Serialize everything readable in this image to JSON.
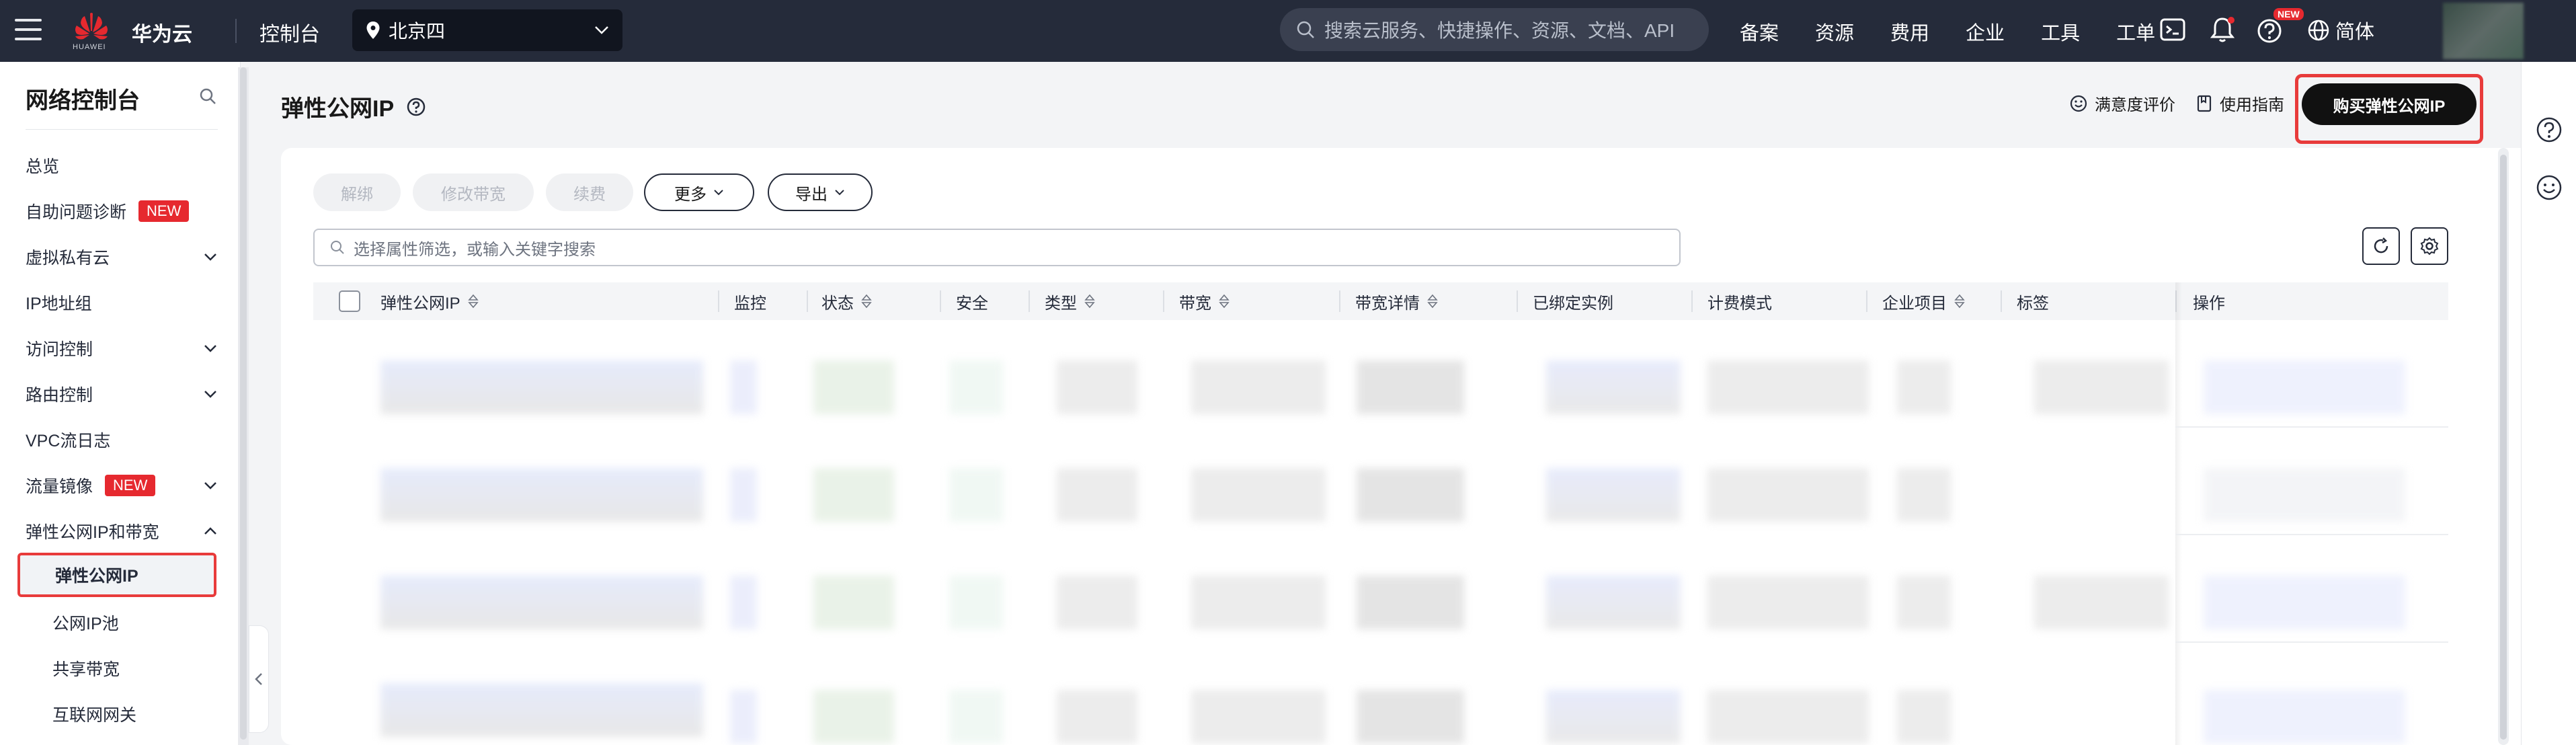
{
  "topbar": {
    "brand_small": "HUAWEI",
    "brand_name": "华为云",
    "console": "控制台",
    "region": "北京四",
    "search_placeholder": "搜索云服务、快捷操作、资源、文档、API",
    "nav": [
      "备案",
      "资源",
      "费用",
      "企业",
      "工具",
      "工单"
    ],
    "notify_badge": "NEW",
    "language": "简体"
  },
  "sidebar": {
    "title": "网络控制台",
    "items": [
      {
        "label": "总览"
      },
      {
        "label": "自助问题诊断",
        "badge": "NEW"
      },
      {
        "label": "虚拟私有云"
      },
      {
        "label": "IP地址组"
      },
      {
        "label": "访问控制"
      },
      {
        "label": "路由控制"
      },
      {
        "label": "VPC流日志"
      },
      {
        "label": "流量镜像",
        "badge": "NEW"
      },
      {
        "label": "弹性公网IP和带宽"
      },
      {
        "label": "弹性公网IP"
      },
      {
        "label": "公网IP池"
      },
      {
        "label": "共享带宽"
      },
      {
        "label": "互联网网关"
      }
    ]
  },
  "main": {
    "title": "弹性公网IP",
    "links": {
      "rating": "满意度评价",
      "guide": "使用指南"
    },
    "buy_button": "购买弹性公网IP",
    "toolbar": {
      "unbind": "解绑",
      "modify_bandwidth": "修改带宽",
      "renew": "续费",
      "more": "更多",
      "export": "导出"
    },
    "filter_placeholder": "选择属性筛选，或输入关键字搜索",
    "columns": [
      "弹性公网IP",
      "监控",
      "状态",
      "安全",
      "类型",
      "带宽",
      "带宽详情",
      "已绑定实例",
      "计费模式",
      "企业项目",
      "标签",
      "操作"
    ]
  },
  "colors": {
    "topbar": "#252b3a",
    "accent_red": "#e6292f",
    "highlight": "#e83b3b",
    "primary_button": "#111111"
  }
}
